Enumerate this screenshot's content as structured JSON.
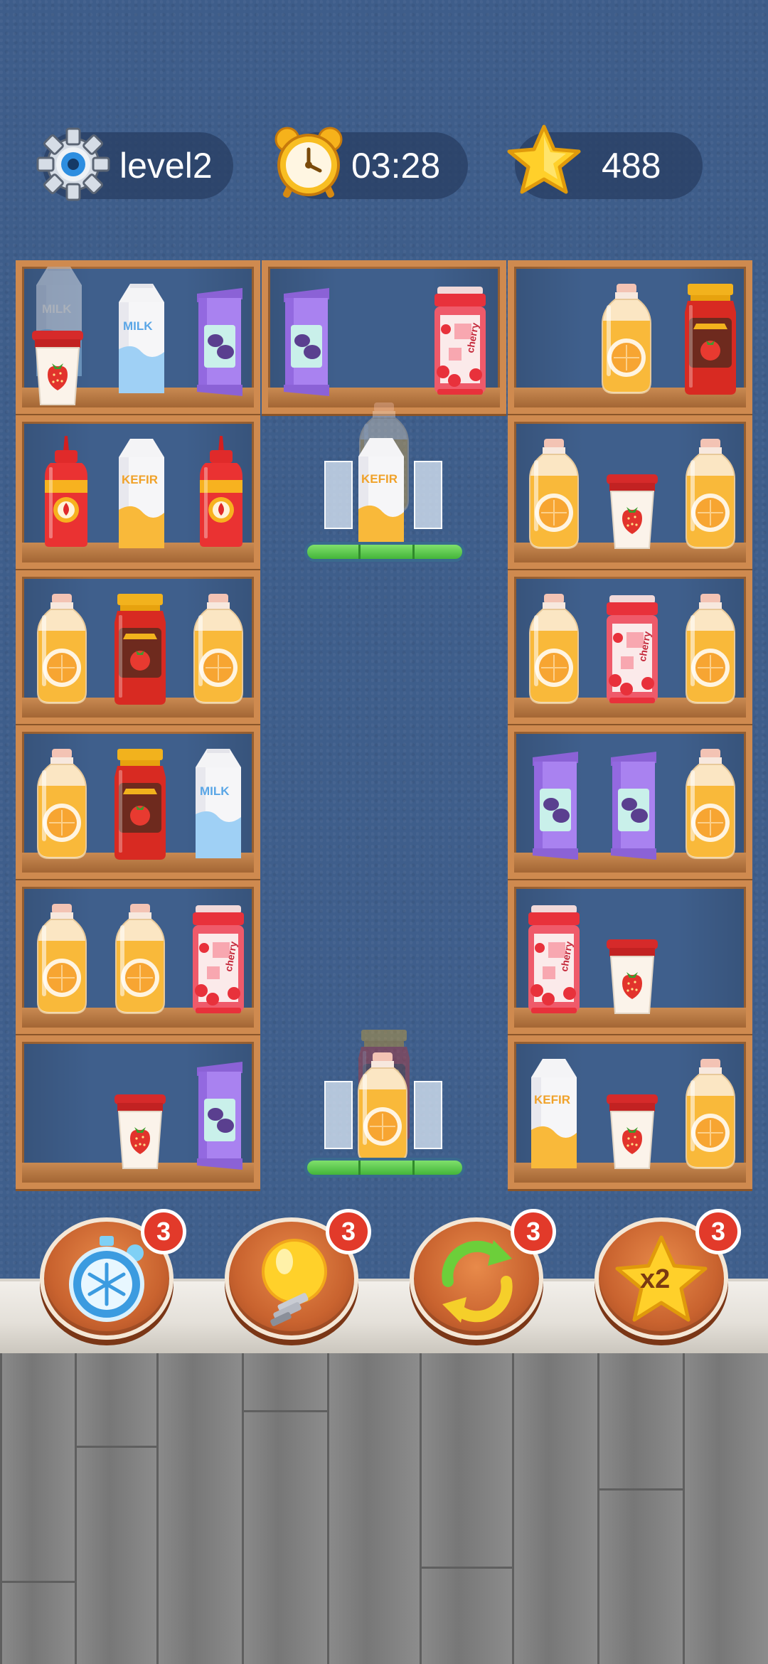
{
  "hud": {
    "level_label": "level2",
    "timer": "03:28",
    "score": "488",
    "settings_icon": "gear-icon",
    "timer_icon": "alarm-clock-icon",
    "score_icon": "star-icon"
  },
  "shelves": {
    "s1": {
      "milk_label": "MILK",
      "ghost_milk_label": "MILK"
    },
    "s2": {
      "jam_label": "cherry"
    },
    "s3": {
      "sauce_label": "sauce"
    },
    "s4": {
      "kefir_label": "KEFIR"
    },
    "s7": {
      "sauce_label": "sauce"
    },
    "s8": {
      "jam_label": "cherry"
    },
    "s9": {
      "sauce_label": "sauce",
      "milk_label": "MILK"
    },
    "s11": {
      "jam_label": "cherry"
    },
    "s12": {
      "jam_label": "cherry"
    },
    "s14": {
      "kefir_label": "KEFIR"
    }
  },
  "platforms": {
    "top": {
      "kefir_label": "KEFIR"
    }
  },
  "boosters": [
    {
      "name": "freeze",
      "icon": "snowflake-stopwatch-icon",
      "count": "3"
    },
    {
      "name": "hint",
      "icon": "lightbulb-icon",
      "count": "3"
    },
    {
      "name": "shuffle",
      "icon": "refresh-arrows-icon",
      "count": "3"
    },
    {
      "name": "double",
      "icon": "star-x2-icon",
      "count": "3",
      "label": "x2"
    }
  ],
  "colors": {
    "wall": "#3f5f8c",
    "shelf_wood": "#cf8a4f",
    "badge": "#e23a2a",
    "platform_green": "#43b53a"
  }
}
